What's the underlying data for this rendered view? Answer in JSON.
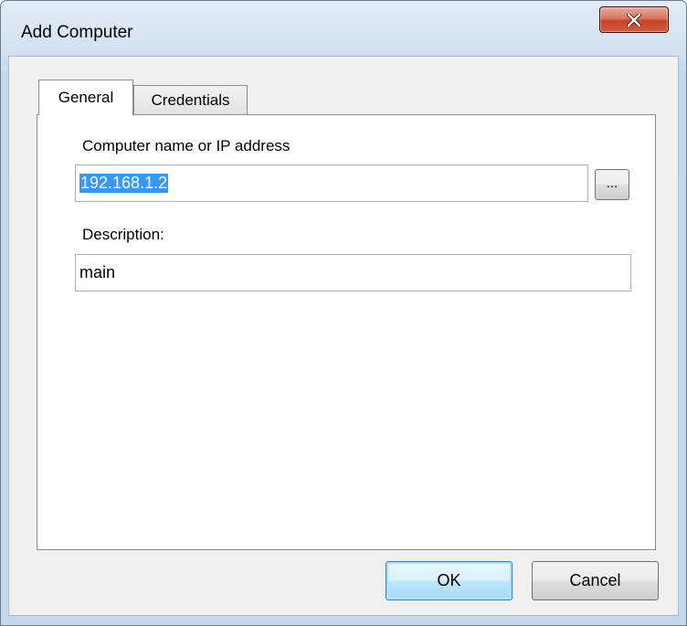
{
  "window": {
    "title": "Add Computer",
    "close_icon": "close-icon"
  },
  "tabs": [
    {
      "label": "General",
      "selected": true
    },
    {
      "label": "Credentials",
      "selected": false
    }
  ],
  "general": {
    "computer_label": "Computer name or IP address",
    "computer_value": "192.168.1.2",
    "browse_label": "...",
    "description_label": "Description:",
    "description_value": "main"
  },
  "buttons": {
    "ok": "OK",
    "cancel": "Cancel"
  },
  "colors": {
    "selection": "#3399ff",
    "close_button": "#c7442a",
    "default_button": "#bee6fd"
  }
}
